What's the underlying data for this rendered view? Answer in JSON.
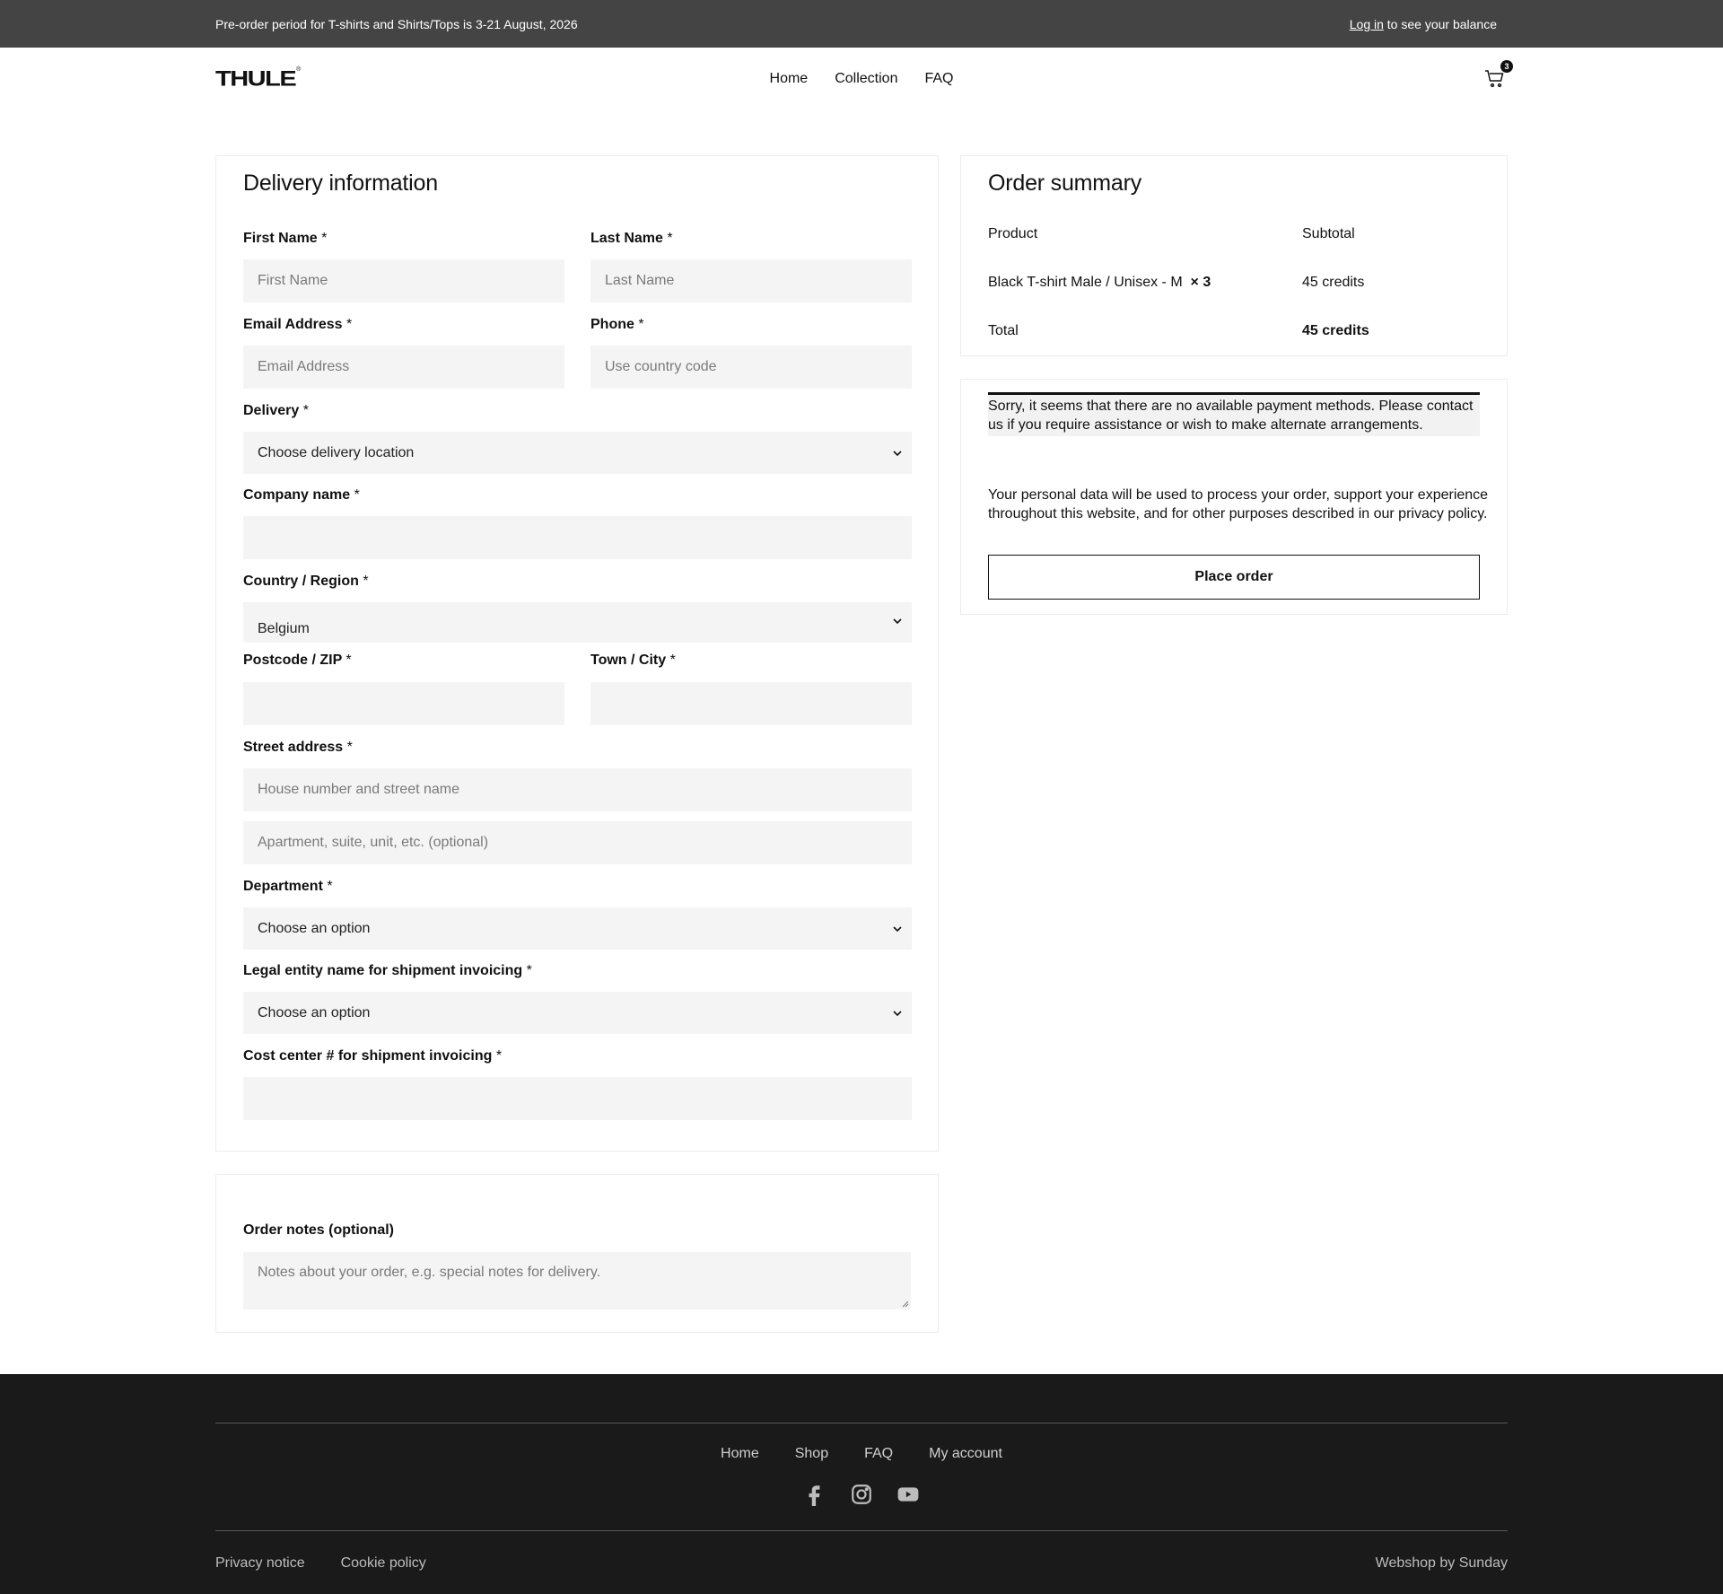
{
  "topbar": {
    "announcement": "Pre-order period for T-shirts and Shirts/Tops is 3-21 August, 2026",
    "login_link": "Log in",
    "login_suffix": " to see your balance"
  },
  "header": {
    "logo_text": "THULE",
    "logo_reg": "®",
    "nav": [
      "Home",
      "Collection",
      "FAQ"
    ],
    "cart_count": "3",
    "cart_icon": "cart-icon"
  },
  "delivery": {
    "title": "Delivery information",
    "first_name": {
      "label": "First Name",
      "placeholder": "First Name"
    },
    "last_name": {
      "label": "Last Name",
      "placeholder": "Last Name"
    },
    "email": {
      "label": "Email Address",
      "placeholder": "Email Address"
    },
    "phone": {
      "label": "Phone",
      "placeholder": "Use country code"
    },
    "delivery": {
      "label": "Delivery",
      "value": "Choose delivery location"
    },
    "company": {
      "label": "Company name",
      "value": ""
    },
    "country": {
      "label": "Country / Region",
      "value": "Belgium"
    },
    "postcode": {
      "label": "Postcode / ZIP",
      "value": ""
    },
    "town": {
      "label": "Town / City",
      "value": ""
    },
    "street": {
      "label": "Street address",
      "placeholder1": "House number and street name",
      "placeholder2": "Apartment, suite, unit, etc. (optional)"
    },
    "department": {
      "label": "Department",
      "value": "Choose an option"
    },
    "legal_entity": {
      "label": "Legal entity name for shipment invoicing",
      "value": "Choose an option"
    },
    "cost_center": {
      "label": "Cost center # for shipment invoicing",
      "value": ""
    },
    "required_mark": "*"
  },
  "notes": {
    "label": "Order notes (optional)",
    "placeholder": "Notes about your order, e.g. special notes for delivery."
  },
  "summary": {
    "title": "Order summary",
    "col_product": "Product",
    "col_subtotal": "Subtotal",
    "item_name": "Black T-shirt Male / Unisex - M",
    "item_qty": "× 3",
    "item_subtotal": "45 credits",
    "total_label": "Total",
    "total_value": "45 credits"
  },
  "payment": {
    "notice": "Sorry, it seems that there are no available payment methods. Please contact us if you require assistance or wish to make alternate arrangements.",
    "privacy": "Your personal data will be used to process your order, support your experience throughout this website, and for other purposes described in our privacy policy.",
    "place_order": "Place order"
  },
  "footer": {
    "links": [
      "Home",
      "Shop",
      "FAQ",
      "My account"
    ],
    "social": [
      "facebook-icon",
      "instagram-icon",
      "youtube-icon"
    ],
    "privacy_notice": "Privacy notice",
    "cookie_policy": "Cookie policy",
    "credit": "Webshop by Sunday"
  },
  "colors": {
    "topbar_bg": "#444444",
    "footer_bg": "#1a1a1a",
    "field_bg": "#f4f4f4"
  }
}
